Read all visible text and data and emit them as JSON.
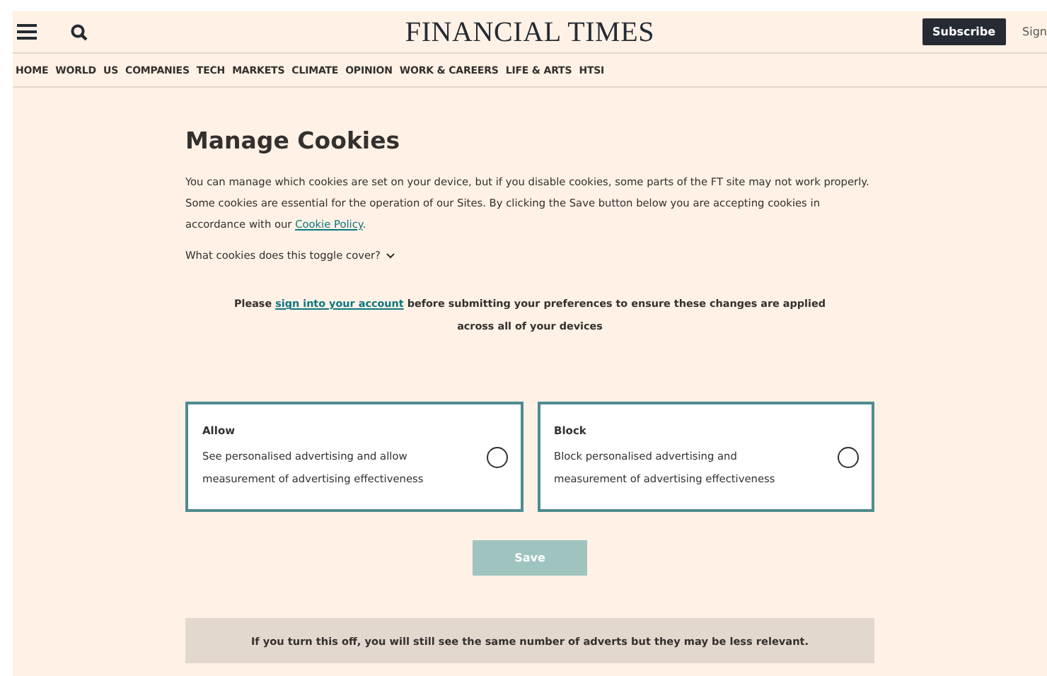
{
  "header": {
    "logo": "FINANCIAL TIMES",
    "subscribe_button": "Subscribe",
    "sign_in_link": "Sign"
  },
  "nav": [
    "HOME",
    "WORLD",
    "US",
    "COMPANIES",
    "TECH",
    "MARKETS",
    "CLIMATE",
    "OPINION",
    "WORK & CAREERS",
    "LIFE & ARTS",
    "HTSI"
  ],
  "title": "Manage Cookies",
  "intro": {
    "before": "You can manage which cookies are set on your device, but if you disable cookies, some parts of the FT site may not work properly. Some cookies are essential for the operation of our Sites. By clicking the Save button below you are accepting cookies in accordance with our ",
    "link": "Cookie Policy",
    "after": "."
  },
  "toggle_disclosure": {
    "label": "What cookies does this toggle cover?",
    "expanded": false
  },
  "sign_in_notice": {
    "before": "Please ",
    "link": "sign into your account",
    "after": " before submitting your preferences to ensure these changes are applied across all of your devices"
  },
  "options": [
    {
      "title": "Allow",
      "description": "See personalised advertising and allow measurement of advertising effectiveness",
      "selected": false
    },
    {
      "title": "Block",
      "description": "Block personalised advertising and measurement of advertising effectiveness",
      "selected": false
    }
  ],
  "save_button": {
    "label": "Save",
    "disabled": true
  },
  "footnote": "If you turn this off, you will still see the same number of adverts but they may be less relevant."
}
